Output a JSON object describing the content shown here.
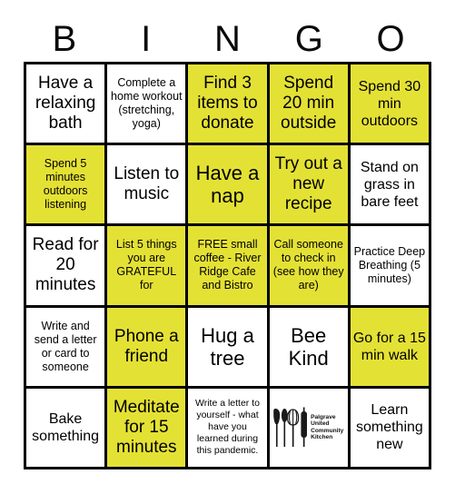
{
  "card": {
    "title": "BINGO",
    "header_letters": [
      "B",
      "I",
      "N",
      "G",
      "O"
    ],
    "marked_color": "#e4e135",
    "unmarked_color": "#ffffff",
    "border_color": "#000000",
    "grid_size": "5x5"
  },
  "cells": [
    {
      "text": "Have a relaxing bath",
      "marked": false,
      "size": "lg"
    },
    {
      "text": "Complete a home workout (stretching, yoga)",
      "marked": false,
      "size": "sm"
    },
    {
      "text": "Find 3 items to donate",
      "marked": true,
      "size": "lg"
    },
    {
      "text": "Spend 20 min outside",
      "marked": true,
      "size": "lg"
    },
    {
      "text": "Spend 30 min outdoors",
      "marked": true,
      "size": "md"
    },
    {
      "text": "Spend 5 minutes outdoors listening",
      "marked": true,
      "size": "sm"
    },
    {
      "text": "Listen to music",
      "marked": false,
      "size": "lg"
    },
    {
      "text": "Have a nap",
      "marked": true,
      "size": "xl"
    },
    {
      "text": "Try out a new recipe",
      "marked": true,
      "size": "lg"
    },
    {
      "text": "Stand on grass in bare feet",
      "marked": false,
      "size": "md"
    },
    {
      "text": "Read for 20 minutes",
      "marked": false,
      "size": "lg"
    },
    {
      "text": "List 5 things you are GRATEFUL for",
      "marked": true,
      "size": "sm"
    },
    {
      "text": "FREE small coffee - River Ridge Cafe and Bistro",
      "marked": true,
      "size": "sm"
    },
    {
      "text": "Call someone to check in (see how they are)",
      "marked": true,
      "size": "sm"
    },
    {
      "text": "Practice Deep Breathing (5 minutes)",
      "marked": false,
      "size": "sm"
    },
    {
      "text": "Write and send a letter or card to someone",
      "marked": false,
      "size": "sm"
    },
    {
      "text": "Phone a friend",
      "marked": true,
      "size": "lg"
    },
    {
      "text": "Hug a tree",
      "marked": false,
      "size": "xl"
    },
    {
      "text": "Bee Kind",
      "marked": false,
      "size": "xl"
    },
    {
      "text": "Go for a 15 min walk",
      "marked": true,
      "size": "md"
    },
    {
      "text": "Bake something",
      "marked": false,
      "size": "md"
    },
    {
      "text": "Meditate for 15 minutes",
      "marked": true,
      "size": "lg"
    },
    {
      "text": "Write a letter to yourself - what have you learned during this pandemic.",
      "marked": false,
      "size": "xs"
    },
    {
      "text": "",
      "marked": false,
      "size": "xs",
      "logo": true
    },
    {
      "text": "Learn something new",
      "marked": false,
      "size": "md"
    }
  ],
  "logo": {
    "name": "Palgrave United Community Kitchen",
    "lines": [
      "Palgrave",
      "United",
      "Community",
      "Kitchen"
    ],
    "utensils": [
      "spatula",
      "spoon",
      "whisk",
      "rolling-pin"
    ]
  }
}
